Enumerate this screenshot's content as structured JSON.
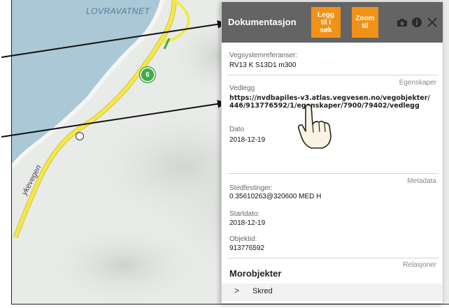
{
  "map": {
    "lake_label": "LOVRAVATNET",
    "road_label": "ykevegen",
    "route_badge": "6",
    "colors": {
      "water": "#aac8d6",
      "road": "#f2e84b",
      "road_outline": "#d1c53a",
      "land": "#e9ebe9"
    }
  },
  "panel": {
    "title": "Dokumentasjon",
    "btn_add_to_search": "Legg\ntil i\nsøk",
    "btn_zoom_to": "Zoom\ntil",
    "icons": [
      "camera-icon",
      "info-icon",
      "close-icon"
    ],
    "colors": {
      "header": "#646464",
      "accent": "#f29118"
    }
  },
  "fields": {
    "vegsystem_label": "Vegsystemreferanser:",
    "vegsystem_value": "RV13 K S13D1 m300",
    "egenskaper_tag": "Egenskaper",
    "vedlegg_label": "Vedlegg",
    "vedlegg_value": "https://nvdbapiles-v3.atlas.vegvesen.no/vegobjekter/446/913776592/1/egenskaper/7900/79402/vedlegg",
    "dato_label": "Dato",
    "dato_value": "2018-12-19",
    "metadata_tag": "Metadata",
    "stedfestinger_label": "Stedfestinger:",
    "stedfestinger_value": "0.35610263@320600 MED H",
    "startdato_label": "Startdato:",
    "startdato_value": "2018-12-19",
    "objektid_label": "Objektid:",
    "objektid_value": "913776592",
    "relasjoner_tag": "Relasjoner",
    "morobjekter_heading": "Morobjekter",
    "skred_chevron": ">",
    "skred_label": "Skred"
  }
}
